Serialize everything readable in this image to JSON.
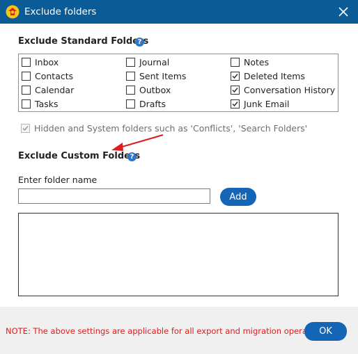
{
  "window": {
    "title": "Exclude folders",
    "titlebar_color": "#0a5b96",
    "icons": {
      "app": "app-logo-icon",
      "close": "close-icon"
    }
  },
  "standard": {
    "title": "Exclude Standard Folders",
    "help_icon": "?",
    "folders": [
      {
        "label": "Inbox",
        "checked": false
      },
      {
        "label": "Journal",
        "checked": false
      },
      {
        "label": "Notes",
        "checked": false
      },
      {
        "label": "Contacts",
        "checked": false
      },
      {
        "label": "Sent Items",
        "checked": false
      },
      {
        "label": "Deleted Items",
        "checked": true
      },
      {
        "label": "Calendar",
        "checked": false
      },
      {
        "label": "Outbox",
        "checked": false
      },
      {
        "label": "Conversation History",
        "checked": true
      },
      {
        "label": "Tasks",
        "checked": false
      },
      {
        "label": "Drafts",
        "checked": false
      },
      {
        "label": "Junk Email",
        "checked": true
      }
    ],
    "hidden_system": {
      "label": "Hidden and System folders such as 'Conflicts', 'Search Folders'",
      "checked": true,
      "disabled": true
    }
  },
  "custom": {
    "title": "Exclude Custom Folders",
    "help_icon": "?",
    "input_label": "Enter folder name",
    "input_value": "",
    "add_label": "Add",
    "list_items": []
  },
  "footer": {
    "note": "NOTE: The above settings are applicable for all export and migration operations.",
    "ok_label": "OK"
  },
  "colors": {
    "accent": "#1565b6",
    "note": "#e01b1b",
    "annotation_arrow": "#e01b1b"
  }
}
